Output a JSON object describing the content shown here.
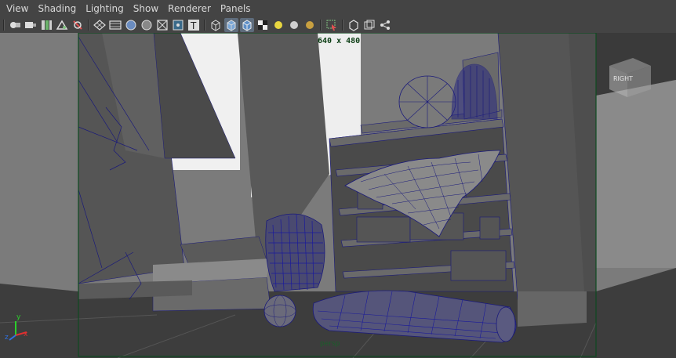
{
  "menus": [
    "View",
    "Shading",
    "Lighting",
    "Show",
    "Renderer",
    "Panels"
  ],
  "toolbar": {
    "groups": [
      [
        "camera-select-icon",
        "camera-attributes-icon",
        "bookmarks-icon",
        "image-plane-icon",
        "2d-pan-zoom-icon"
      ],
      [
        "grid-icon",
        "film-gate-icon",
        "resolution-gate-icon",
        "gate-mask-icon",
        "field-chart-icon",
        "safe-action-icon"
      ],
      [
        "wireframe-icon",
        "smooth-shade-icon",
        "wireframe-on-shaded-icon",
        "textured-icon",
        "default-light-icon",
        "all-lights-icon",
        "shadows-icon"
      ],
      [
        "isolate-select-icon"
      ],
      [
        "xray-icon",
        "xray-joints-icon",
        "share-icon"
      ]
    ]
  },
  "viewport": {
    "resolution_label": "640 x 480",
    "camera_label": "persp",
    "viewcube_label": "RIGHT",
    "axis_y": "y",
    "axis_x": "x",
    "axis_z": "z"
  },
  "colors": {
    "background": "#444444",
    "viewport_bg": "#7e7e7e",
    "wire": "#1a1a7a",
    "gate_line": "#0e4a20"
  }
}
